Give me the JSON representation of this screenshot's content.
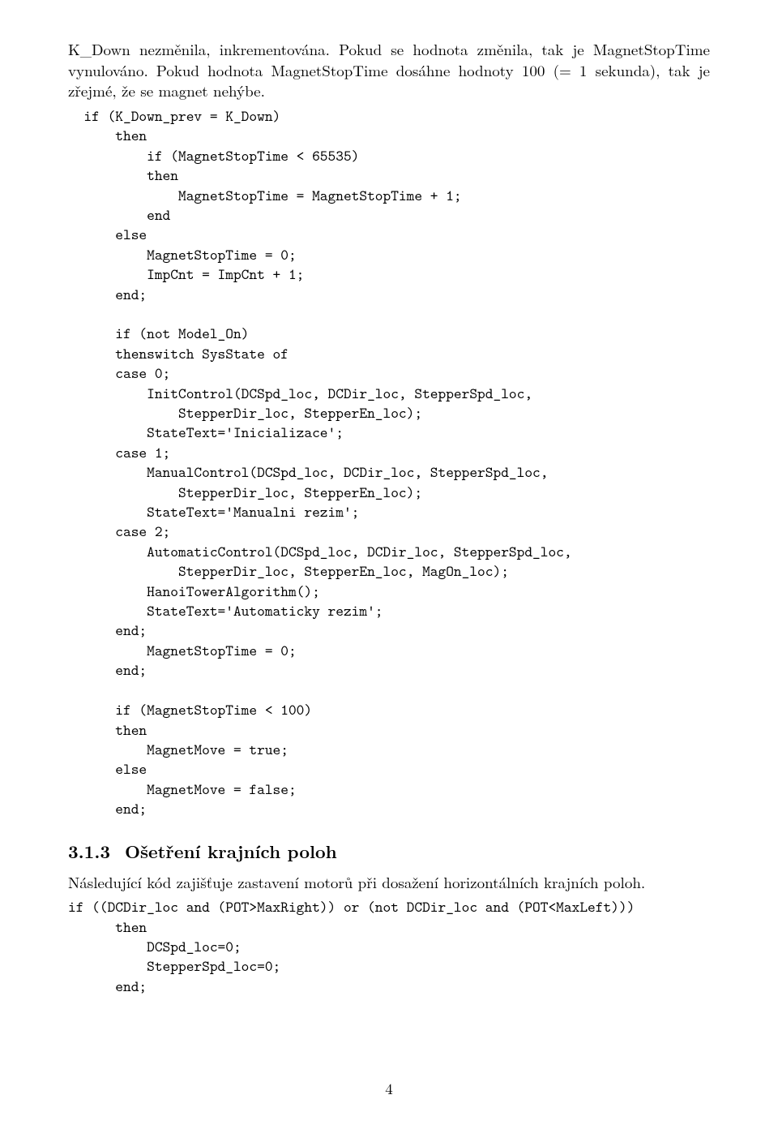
{
  "para1": "K_Down nezměnila, inkrementována. Pokud se hodnota změnila, tak je MagnetStopTime vynulováno. Pokud hodnota MagnetStopTime dosáhne hodnoty 100 (= 1 sekunda), tak je zřejmé, že se magnet nehýbe.",
  "code1": "  if (K_Down_prev = K_Down)\n      then\n          if (MagnetStopTime < 65535)\n          then\n              MagnetStopTime = MagnetStopTime + 1;\n          end\n      else\n          MagnetStopTime = 0;\n          ImpCnt = ImpCnt + 1;\n      end;\n\n      if (not Model_On)\n      thenswitch SysState of\n      case 0;\n          InitControl(DCSpd_loc, DCDir_loc, StepperSpd_loc,\n              StepperDir_loc, StepperEn_loc);\n          StateText='Inicializace';\n      case 1;\n          ManualControl(DCSpd_loc, DCDir_loc, StepperSpd_loc,\n              StepperDir_loc, StepperEn_loc);\n          StateText='Manualni rezim';\n      case 2;\n          AutomaticControl(DCSpd_loc, DCDir_loc, StepperSpd_loc,\n              StepperDir_loc, StepperEn_loc, MagOn_loc);\n          HanoiTowerAlgorithm();\n          StateText='Automaticky rezim';\n      end;\n          MagnetStopTime = 0;\n      end;\n\n      if (MagnetStopTime < 100)\n      then\n          MagnetMove = true;\n      else\n          MagnetMove = false;\n      end;",
  "heading": {
    "num": "3.1.3",
    "title": "Ošetření krajních poloh"
  },
  "para2": "Následující kód zajišťuje zastavení motorů při dosažení horizontálních krajních poloh.",
  "code2": "if ((DCDir_loc and (POT>MaxRight)) or (not DCDir_loc and (POT<MaxLeft)))\n      then\n          DCSpd_loc=0;\n          StepperSpd_loc=0;\n      end;",
  "pageNumber": "4"
}
